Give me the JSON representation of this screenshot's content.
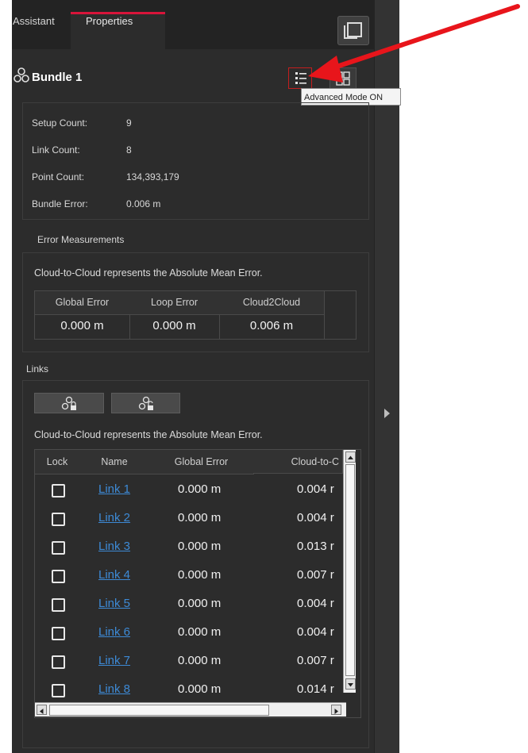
{
  "tabs": [
    {
      "label": "Assistant"
    },
    {
      "label": "Properties"
    }
  ],
  "bundle": {
    "title": "Bundle 1",
    "tooltip": "Advanced Mode ON",
    "info": [
      {
        "label": "Setup Count:",
        "value": "9"
      },
      {
        "label": "Link Count:",
        "value": "8"
      },
      {
        "label": "Point Count:",
        "value": "134,393,179"
      },
      {
        "label": "Bundle Error:",
        "value": "0.006 m"
      }
    ]
  },
  "error_measurements": {
    "title": "Error Measurements",
    "note": "Cloud-to-Cloud represents the Absolute Mean Error.",
    "headers": [
      "Global Error",
      "Loop Error",
      "Cloud2Cloud"
    ],
    "values": [
      "0.000 m",
      "0.000 m",
      "0.006 m"
    ]
  },
  "links": {
    "title": "Links",
    "note": "Cloud-to-Cloud represents the Absolute Mean Error.",
    "headers": [
      "Lock",
      "Name",
      "Global Error",
      "Cloud-to-C"
    ],
    "rows": [
      {
        "name": "Link 1",
        "global_error": "0.000 m",
        "cloud": "0.004 r"
      },
      {
        "name": "Link 2",
        "global_error": "0.000 m",
        "cloud": "0.004 r"
      },
      {
        "name": "Link 3",
        "global_error": "0.000 m",
        "cloud": "0.013 r"
      },
      {
        "name": "Link 4",
        "global_error": "0.000 m",
        "cloud": "0.007 r"
      },
      {
        "name": "Link 5",
        "global_error": "0.000 m",
        "cloud": "0.004 r"
      },
      {
        "name": "Link 6",
        "global_error": "0.000 m",
        "cloud": "0.004 r"
      },
      {
        "name": "Link 7",
        "global_error": "0.000 m",
        "cloud": "0.007 r"
      },
      {
        "name": "Link 8",
        "global_error": "0.000 m",
        "cloud": "0.014 r"
      }
    ]
  },
  "colors": {
    "accent": "#d8143a",
    "link": "#3d8ad6",
    "arrow": "#e8151b"
  }
}
